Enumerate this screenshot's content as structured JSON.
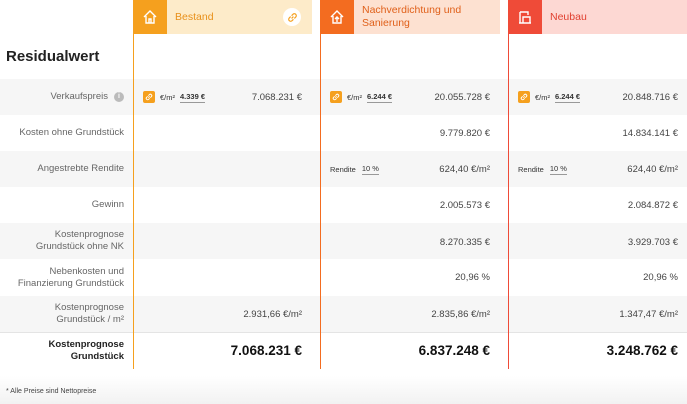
{
  "title": "Residualwert",
  "columns": [
    {
      "name": "Bestand",
      "accent": "#f5a01e",
      "light": "#fdebc9",
      "icon": "house-icon"
    },
    {
      "name": "Nachverdichtung und Sanierung",
      "accent": "#f36c20",
      "light": "#fde1d1",
      "icon": "house-upload-icon"
    },
    {
      "name": "Neubau",
      "accent": "#ef4b38",
      "light": "#fdd8d3",
      "icon": "building-icon"
    }
  ],
  "rows": {
    "verkaufspreis": {
      "label": "Verkaufspreis",
      "unit": "€/m²",
      "values": [
        {
          "ppm": "4.339 €",
          "total": "7.068.231 €"
        },
        {
          "ppm": "6.244 €",
          "total": "20.055.728 €"
        },
        {
          "ppm": "6.244 €",
          "total": "20.848.716 €"
        }
      ]
    },
    "kosten": {
      "label": "Kosten ohne Grundstück",
      "values": [
        "",
        "9.779.820 €",
        "14.834.141 €"
      ]
    },
    "rendite": {
      "label": "Angestrebte Rendite",
      "rendite_label": "Rendite",
      "values": [
        {
          "pct": "",
          "value": ""
        },
        {
          "pct": "10 %",
          "value": "624,40 €/m²"
        },
        {
          "pct": "10 %",
          "value": "624,40 €/m²"
        }
      ]
    },
    "gewinn": {
      "label": "Gewinn",
      "values": [
        "",
        "2.005.573 €",
        "2.084.872 €"
      ]
    },
    "kp_ohne_nk": {
      "label_line1": "Kostenprognose",
      "label_line2": "Grundstück ohne NK",
      "values": [
        "",
        "8.270.335 €",
        "3.929.703 €"
      ]
    },
    "nebenkosten": {
      "label_line1": "Nebenkosten und",
      "label_line2": "Finanzierung Grundstück",
      "values": [
        "",
        "20,96 %",
        "20,96 %"
      ]
    },
    "kp_m2": {
      "label_line1": "Kostenprognose",
      "label_line2": "Grundstück / m²",
      "values": [
        "2.931,66 €/m²",
        "2.835,86 €/m²",
        "1.347,47 €/m²"
      ]
    },
    "kp_total": {
      "label_line1": "Kostenprognose",
      "label_line2": "Grundstück",
      "values": [
        "7.068.231 €",
        "6.837.248 €",
        "3.248.762 €"
      ]
    }
  },
  "footnote": "* Alle Preise sind Nettopreise"
}
